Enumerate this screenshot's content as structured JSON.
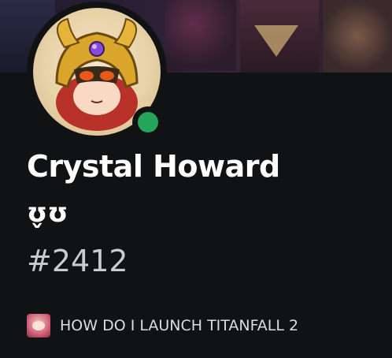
{
  "profile": {
    "display_name": "Crystal Howard",
    "pronoun_emote": "ʊ̬ʊ",
    "discriminator": "#2412",
    "custom_status": "HOW DO I LAUNCH TITANFALL 2",
    "status": "online"
  },
  "colors": {
    "background": "#111214",
    "online": "#23a55a",
    "text_primary": "#ffffff",
    "text_secondary": "#c9cbcf"
  },
  "icons": {
    "avatar": "armored-anime-character-avatar",
    "status_emoji": "anime-character-emoji"
  }
}
